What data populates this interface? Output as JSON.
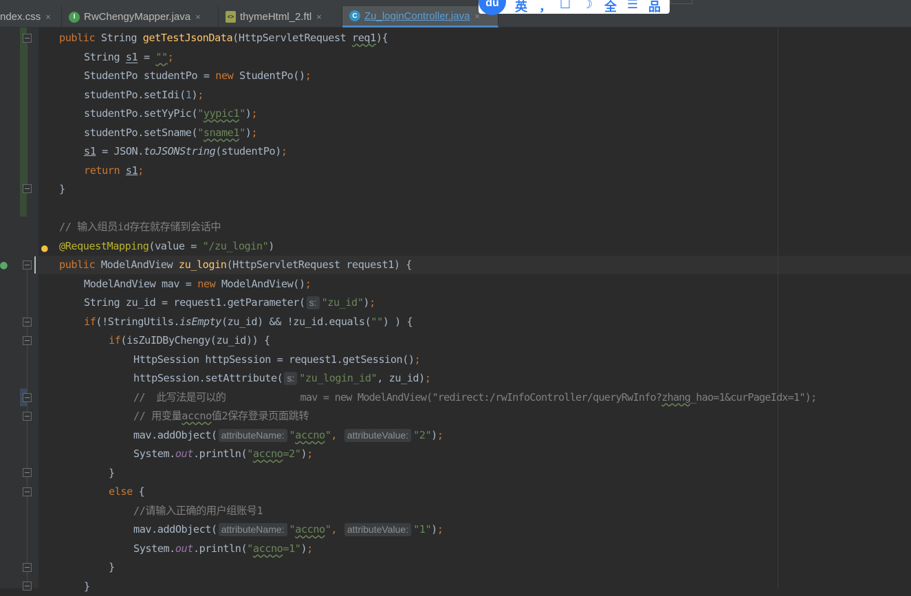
{
  "tabs": [
    {
      "label": "ndex.css",
      "icon": "css-file-icon",
      "active": false
    },
    {
      "label": "RwChengyMapper.java",
      "icon": "interface-file-icon",
      "icon_glyph": "I",
      "active": false
    },
    {
      "label": "thymeHtml_2.ftl",
      "icon": "ftl-file-icon",
      "active": false
    },
    {
      "label": "Zu_loginController.java",
      "icon": "class-file-icon",
      "icon_glyph": "C",
      "active": true
    }
  ],
  "tab_close_glyph": "×",
  "ime_toolbar": {
    "logo": "du",
    "items": [
      "英",
      "，",
      "☐",
      "☽",
      "全",
      "☰",
      "品"
    ]
  },
  "colors": {
    "background": "#2b2b2b",
    "keyword": "#cc7832",
    "method": "#ffc66d",
    "string": "#6a8759",
    "number": "#6897bb",
    "comment": "#808080",
    "annotation": "#bbb529",
    "text": "#a9b7c6",
    "active_tab_text": "#5c9fd6"
  },
  "code": {
    "l1": {
      "a": "public",
      "b": "String",
      "fn": "getTestJsonData",
      "c": "(HttpServletRequest ",
      "p": "req1",
      "d": "){"
    },
    "l2": {
      "a": "String ",
      "v": "s1",
      "b": " = ",
      "s": "\"\"",
      "e": ";"
    },
    "l3": {
      "a": "StudentPo studentPo = ",
      "k": "new",
      "b": " StudentPo()",
      "e": ";"
    },
    "l4": {
      "a": "studentPo.setIdi(",
      "n": "1",
      "b": ")",
      "e": ";"
    },
    "l5": {
      "a": "studentPo.setYyPic(",
      "q1": "\"",
      "s": "yypic1",
      "q2": "\"",
      "b": ")",
      "e": ";"
    },
    "l6": {
      "a": "studentPo.setSname(",
      "q1": "\"",
      "s": "sname1",
      "q2": "\"",
      "b": ")",
      "e": ";"
    },
    "l7": {
      "v": "s1",
      "a": " = JSON.",
      "m": "toJSONString",
      "b": "(studentPo)",
      "e": ";"
    },
    "l8": {
      "k": "return",
      "v": "s1",
      "e": ";"
    },
    "l9": {
      "a": "}"
    },
    "l10": {
      "c": "// 输入组员id存在就存储到会话中"
    },
    "l11": {
      "ann": "@RequestMapping",
      "a": "(value = ",
      "s": "\"/zu_login\"",
      "b": ")"
    },
    "l12": {
      "k1": "public",
      "a": "ModelAndView",
      "fn": "zu_login",
      "b": "(HttpServletRequest request1) {"
    },
    "l13": {
      "a": "ModelAndView mav = ",
      "k": "new",
      "b": " ModelAndView()",
      "e": ";"
    },
    "l14": {
      "a": "String zu_id = request1.getParameter(",
      "h": "s:",
      "s": "\"zu_id\"",
      "b": ")",
      "e": ";"
    },
    "l15": {
      "k": "if",
      "a": "(!StringUtils.",
      "m": "isEmpty",
      "b": "(zu_id) && !zu_id.equals(",
      "s": "\"\"",
      "c": ") ) {"
    },
    "l16": {
      "k": "if",
      "a": "(isZuIDByChengy(zu_id)) {"
    },
    "l17": {
      "a": "HttpSession httpSession = request1.getSession()",
      "e": ";"
    },
    "l18": {
      "a": "httpSession.setAttribute(",
      "h": "s:",
      "s": "\"zu_login_id\"",
      "b": ", zu_id)",
      "e": ";"
    },
    "l19": {
      "c1": "//  此写法是可以的             mav = new ModelAndView(\"redirect:/rwInfoController/queryRwInfo?",
      "cw": "zhang",
      "c2": "_hao=1&curPageIdx=1\");"
    },
    "l20": {
      "c1": "// 用变量",
      "cw": "accno",
      "c2": "值2保存登录页面跳转"
    },
    "l21": {
      "a": "mav.addObject(",
      "h1": "attributeName:",
      "q1": "\"",
      "s1": "accno",
      "q2": "\"",
      "b": ", ",
      "h2": "attributeValue:",
      "s2": "\"2\"",
      "c": ")",
      "e": ";"
    },
    "l22": {
      "a": "System.",
      "o": "out",
      "b": ".println(",
      "q1": "\"",
      "s": "accno",
      "s2": "=2\"",
      "c": ")",
      "e": ";"
    },
    "l23": {
      "a": "}"
    },
    "l24": {
      "k": "else",
      "a": " {"
    },
    "l25": {
      "c": "//请输入正确的用户组账号1"
    },
    "l26": {
      "a": "mav.addObject(",
      "h1": "attributeName:",
      "q1": "\"",
      "s1": "accno",
      "q2": "\"",
      "b": ", ",
      "h2": "attributeValue:",
      "s2": "\"1\"",
      "c": ")",
      "e": ";"
    },
    "l27": {
      "a": "System.",
      "o": "out",
      "b": ".println(",
      "q1": "\"",
      "s": "accno",
      "s2": "=1\"",
      "c": ")",
      "e": ";"
    },
    "l28": {
      "a": "}"
    },
    "l29": {
      "a": "}"
    }
  }
}
